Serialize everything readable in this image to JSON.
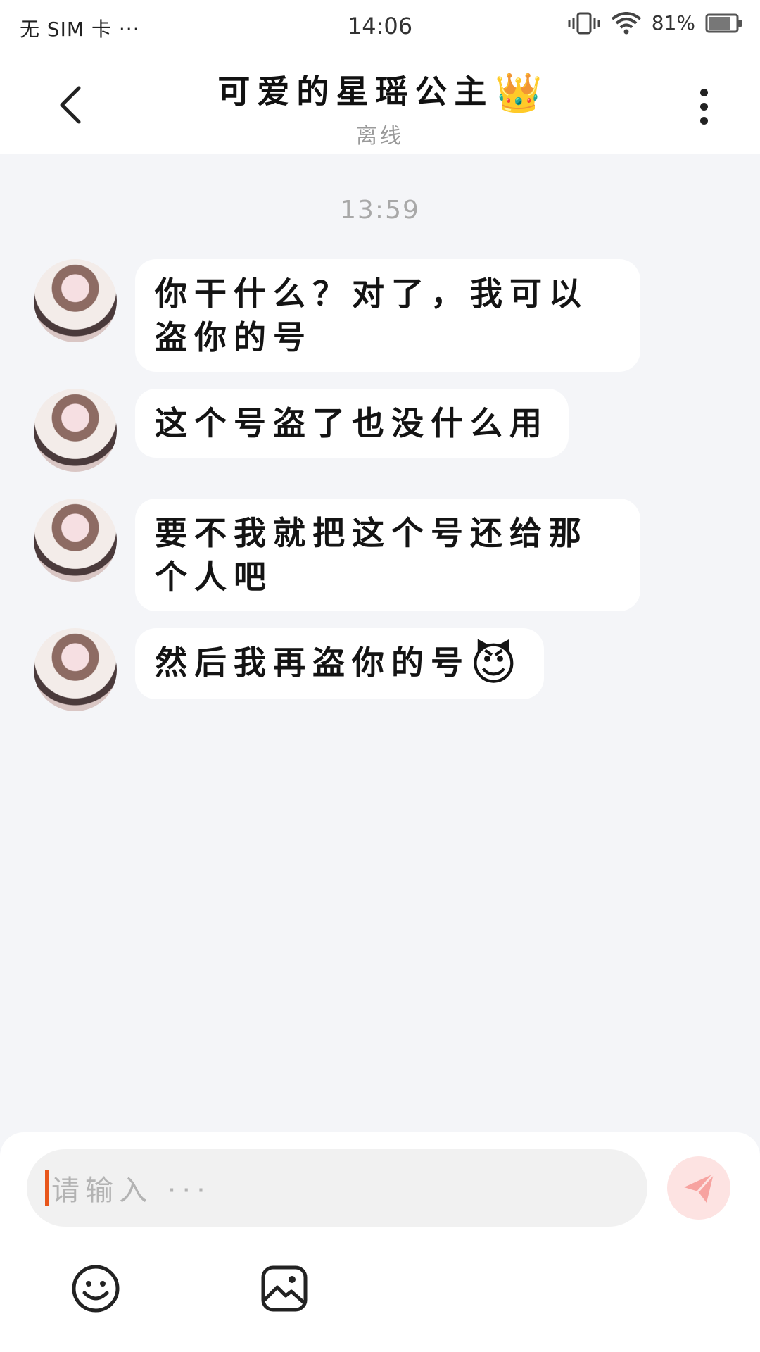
{
  "status_bar": {
    "carrier": "无 SIM 卡 ···",
    "time": "14:06",
    "battery": "81%",
    "battery_level": 0.81,
    "icons": [
      "vibrate-icon",
      "wifi-icon",
      "battery-icon"
    ]
  },
  "header": {
    "title": "可爱的星瑶公主",
    "title_emoji": "👑",
    "status": "离线",
    "back_icon": "chevron-left-icon",
    "more_icon": "more-vertical-icon"
  },
  "chat": {
    "timestamp": "13:59",
    "messages": [
      {
        "text": "你干什么？对了，我可以盗你的号"
      },
      {
        "text": "这个号盗了也没什么用"
      },
      {
        "text": "要不我就把这个号还给那个人吧"
      },
      {
        "text": "然后我再盗你的号",
        "emoji": "😈"
      }
    ]
  },
  "composer": {
    "placeholder": "请输入 ···",
    "send_icon": "send-icon",
    "emoji_icon": "smile-icon",
    "image_icon": "image-icon"
  },
  "colors": {
    "background": "#f4f5f8",
    "caret": "#e8561b",
    "send_button": "#fde3e2",
    "send_arrow": "#f7a3a0"
  }
}
